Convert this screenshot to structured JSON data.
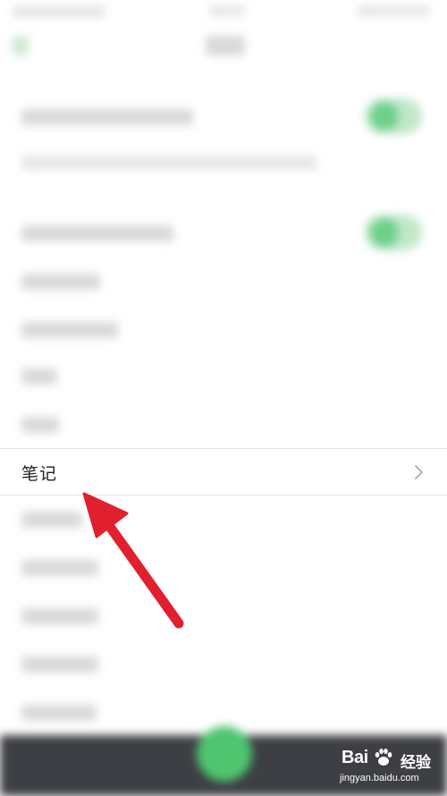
{
  "settings": {
    "notes_label": "笔记"
  },
  "watermark": {
    "brand": "Bai",
    "brand_suffix": "经验",
    "url": "jingyan.baidu.com"
  },
  "icons": {
    "chevron": "chevron-right-icon",
    "arrow": "red-arrow-icon",
    "paw": "baidu-paw-icon"
  },
  "colors": {
    "toggle_on": "#4fc56f",
    "arrow": "#e0202e",
    "bottom_bar": "#3d3f44"
  }
}
